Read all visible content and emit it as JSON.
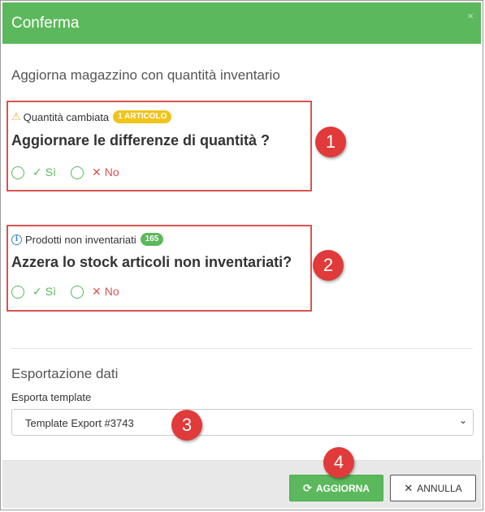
{
  "dialog": {
    "title": "Conferma",
    "close_icon": "×",
    "subtitle": "Aggiorna magazzino con quantità inventario"
  },
  "section1": {
    "icon": "warning-icon",
    "label": "Quantità cambiata",
    "badge": "1 ARTICOLO",
    "question": "Aggiornare le differenze di quantità ?",
    "yes": "Sì",
    "no": "No"
  },
  "section2": {
    "icon": "info-icon",
    "label": "Prodotti non inventariati",
    "badge": "165",
    "question": "Azzera lo stock articoli non inventariati?",
    "yes": "Sì",
    "no": "No"
  },
  "export": {
    "title": "Esportazione dati",
    "template_label": "Esporta template",
    "template_value": "Template Export #3743"
  },
  "footer": {
    "update_label": "AGGIORNA",
    "cancel_label": "ANNULLA"
  },
  "markers": [
    "1",
    "2",
    "3",
    "4"
  ],
  "colors": {
    "header": "#5cb85c",
    "highlight_border": "#d9534f",
    "marker": "#e03a3a",
    "badge_warning": "#f0c419",
    "badge_count": "#5cb85c"
  }
}
